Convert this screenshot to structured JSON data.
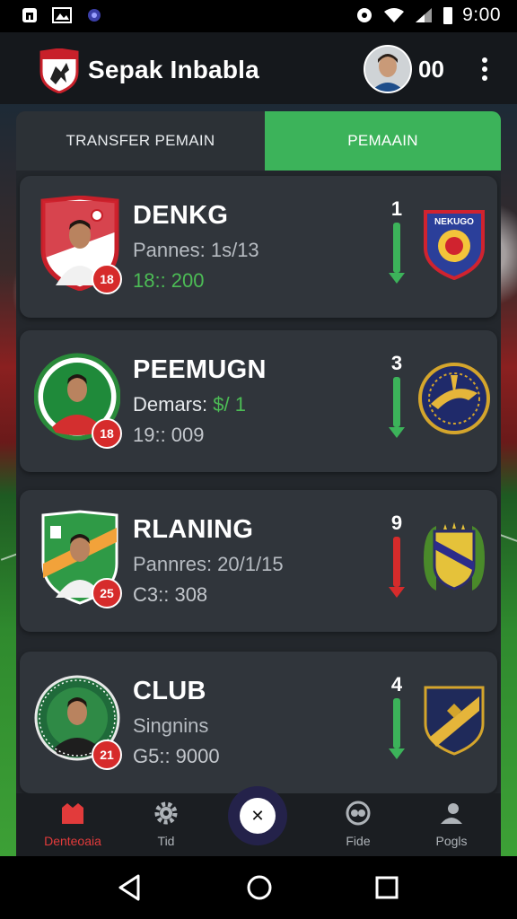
{
  "app": {
    "title": "Sepak Inbabla",
    "coins": "00"
  },
  "status": {
    "time": "9:00"
  },
  "tabs": [
    {
      "label": "TRANSFER PEMAIN",
      "active": false
    },
    {
      "label": "PEMAAIN",
      "active": true
    }
  ],
  "players": [
    {
      "name": "DENKG",
      "line1": "Pannes: 1s/13",
      "line2": "18:: 200",
      "line2_color": "green",
      "badge": "18",
      "rank": "1",
      "trend": "green",
      "crest_shape": "shield-red"
    },
    {
      "name": "PEEMUGN",
      "line1_label": "Demars: ",
      "line1_value": "$/ 1",
      "line2": "19:: 009",
      "badge": "18",
      "rank": "3",
      "trend": "green",
      "crest_shape": "circle"
    },
    {
      "name": "RLANING",
      "line1": "Pannres: 20/1/15",
      "line2": "C3:: 308",
      "badge": "25",
      "rank": "9",
      "trend": "red",
      "crest_shape": "shield-green"
    },
    {
      "name": "CLUB",
      "line1": "Singnins",
      "line2": "G5:: 9000",
      "badge": "21",
      "rank": "4",
      "trend": "green",
      "crest_shape": "circle"
    }
  ],
  "club_badges": [
    "NEKUGO"
  ],
  "nav": [
    {
      "label": "Denteoaia",
      "icon": "home-icon",
      "active": true
    },
    {
      "label": "Tid",
      "icon": "gear-icon",
      "active": false
    },
    {
      "label": "Fide",
      "icon": "ball-icon",
      "active": false
    },
    {
      "label": "Pogls",
      "icon": "profile-icon",
      "active": false
    }
  ],
  "colors": {
    "accent": "#3cb35a",
    "down": "#d62b2b",
    "panel": "#23272c",
    "card": "#30353b"
  }
}
